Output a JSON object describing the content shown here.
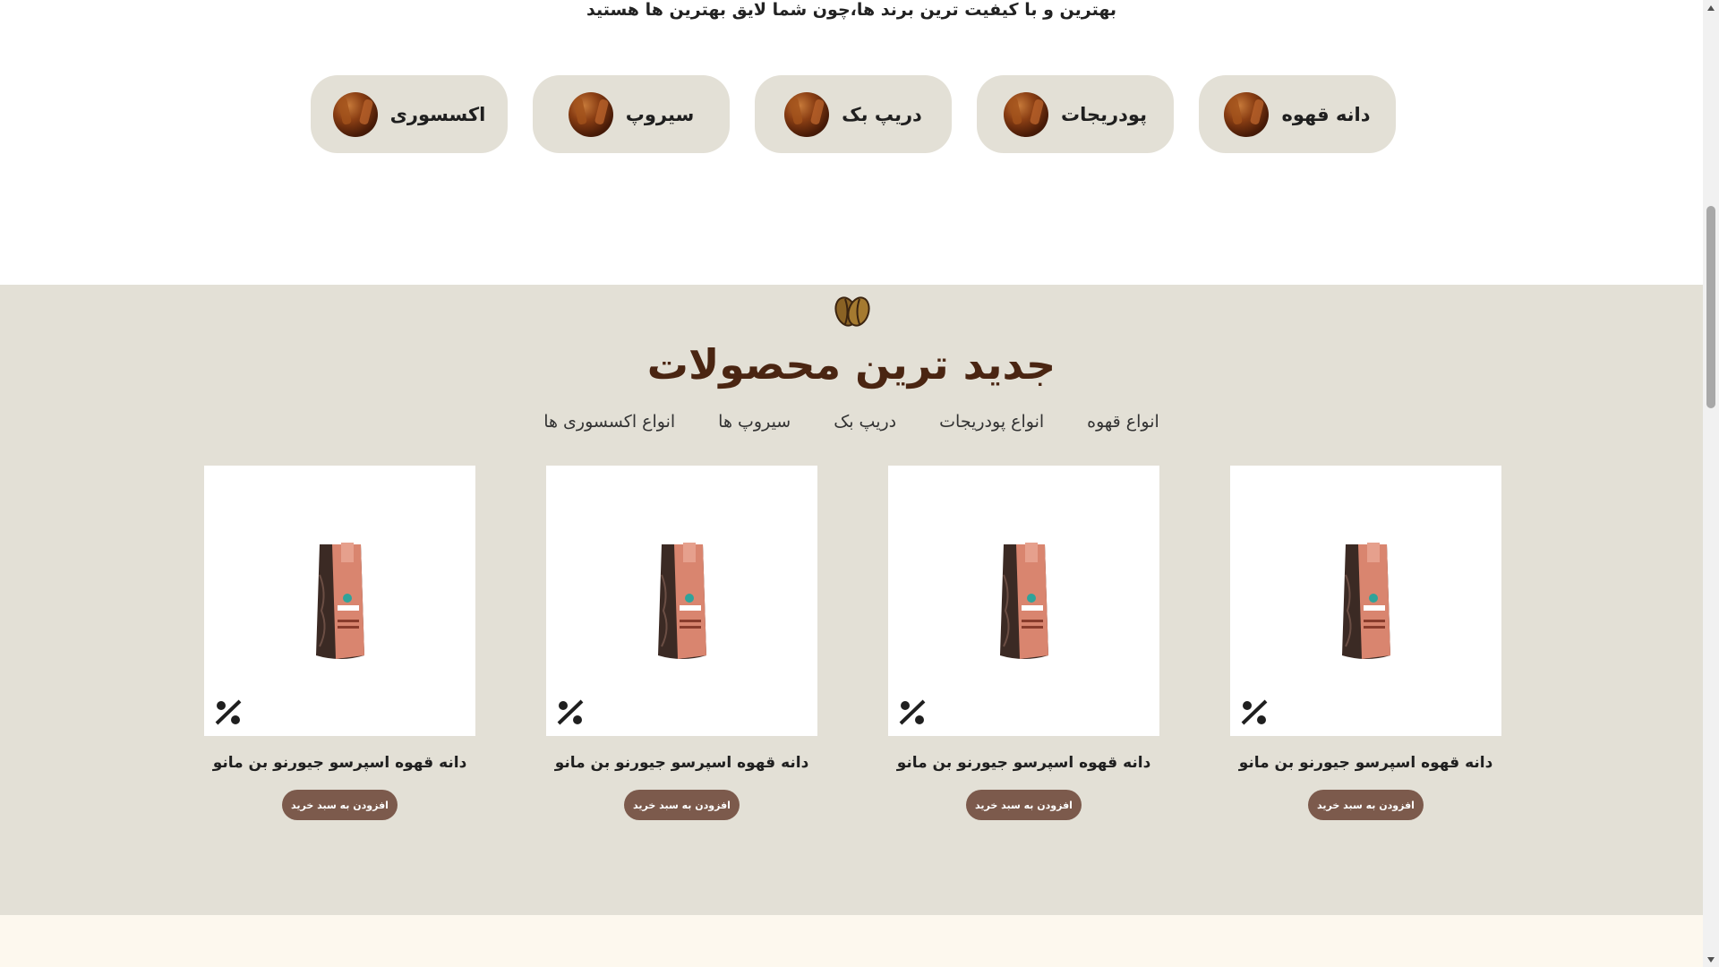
{
  "tagline": "بهترین و با کیفیت ترین برند ها،چون شما لایق بهترین ها هستید",
  "categories": [
    {
      "label": "دانه قهوه",
      "icon": "coffee-beans-thumbnail"
    },
    {
      "label": "پودریجات",
      "icon": "coffee-beans-thumbnail"
    },
    {
      "label": "دریپ بک",
      "icon": "coffee-beans-thumbnail"
    },
    {
      "label": "سیروپ",
      "icon": "coffee-beans-thumbnail"
    },
    {
      "label": "اکسسوری",
      "icon": "coffee-beans-thumbnail"
    }
  ],
  "products_section": {
    "icon": "coffee-bean-icon",
    "title": "جدید ترین محصولات",
    "tabs": [
      "انواع قهوه",
      "انواع پودریجات",
      "دریپ بک",
      "سیروپ ها",
      "انواع اکسسوری ها"
    ],
    "products": [
      {
        "name": "دانه قهوه اسپرسو جیورنو بن مانو",
        "button": "افزودن به سبد خرید",
        "badge": "discount-percent-icon"
      },
      {
        "name": "دانه قهوه اسپرسو جیورنو بن مانو",
        "button": "افزودن به سبد خرید",
        "badge": "discount-percent-icon"
      },
      {
        "name": "دانه قهوه اسپرسو جیورنو بن مانو",
        "button": "افزودن به سبد خرید",
        "badge": "discount-percent-icon"
      },
      {
        "name": "دانه قهوه اسپرسو جیورنو بن مانو",
        "button": "افزودن به سبد خرید",
        "badge": "discount-percent-icon"
      }
    ]
  },
  "colors": {
    "accent_brown": "#4a2512",
    "button_brown": "#7c5a4c",
    "section_beige": "#e3e0d6",
    "footer_cream": "#fdf8ee"
  }
}
